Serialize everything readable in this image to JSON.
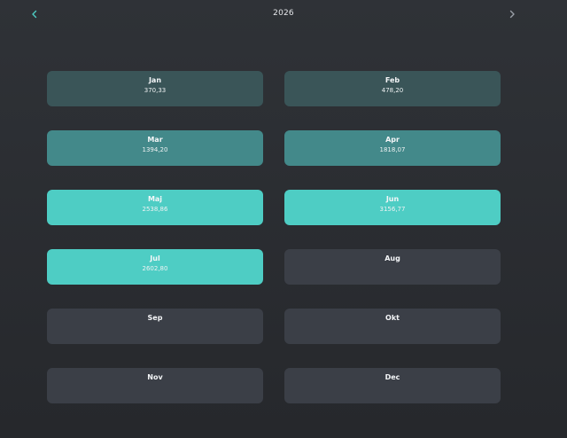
{
  "header": {
    "year": "2026",
    "prev_icon": "chevron-left-icon",
    "next_icon": "chevron-right-icon",
    "accent_color": "#4ecdc4"
  },
  "months": [
    {
      "name": "Jan",
      "value": "370,33",
      "color": "#3a5558"
    },
    {
      "name": "Feb",
      "value": "478,20",
      "color": "#3a5558"
    },
    {
      "name": "Mar",
      "value": "1394,20",
      "color": "#43898a"
    },
    {
      "name": "Apr",
      "value": "1818,07",
      "color": "#43898a"
    },
    {
      "name": "Maj",
      "value": "2538,86",
      "color": "#4ecdc4"
    },
    {
      "name": "Jun",
      "value": "3156,77",
      "color": "#4ecdc4"
    },
    {
      "name": "Jul",
      "value": "2602,80",
      "color": "#4ecdc4"
    },
    {
      "name": "Aug",
      "value": "",
      "color": "#3b3f47"
    },
    {
      "name": "Sep",
      "value": "",
      "color": "#3b3f47"
    },
    {
      "name": "Okt",
      "value": "",
      "color": "#3b3f47"
    },
    {
      "name": "Nov",
      "value": "",
      "color": "#3b3f47"
    },
    {
      "name": "Dec",
      "value": "",
      "color": "#3b3f47"
    }
  ]
}
